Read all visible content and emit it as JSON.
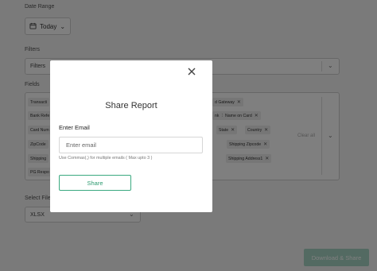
{
  "date_range": {
    "label": "Date Range",
    "value": "Today"
  },
  "filters": {
    "label": "Filters",
    "placeholder": "Filters"
  },
  "fields": {
    "label": "Fields",
    "chips": [
      {
        "text": "Transacti"
      },
      {
        "text": "Bank Refe"
      },
      {
        "text": "Card Num"
      },
      {
        "text": "ZipCode"
      },
      {
        "text": "Shipping"
      },
      {
        "text": "PG Respo"
      },
      {
        "text": "d Gateway"
      },
      {
        "text": "nk"
      },
      {
        "text": "Name on Card"
      },
      {
        "text": "State"
      },
      {
        "text": "Country"
      },
      {
        "text": "Shipping Zipcode"
      },
      {
        "text": "Shipping Address1"
      }
    ],
    "clear_label": "Clear all"
  },
  "file_format": {
    "label": "Select File F",
    "value": "XLSX"
  },
  "download_label": "Download & Share",
  "modal": {
    "title": "Share Report",
    "email_label": "Enter Email",
    "email_placeholder": "Enter email",
    "hint": "Use Commas(,) for multiple emails ( Max upto 3 )",
    "share_label": "Share"
  }
}
